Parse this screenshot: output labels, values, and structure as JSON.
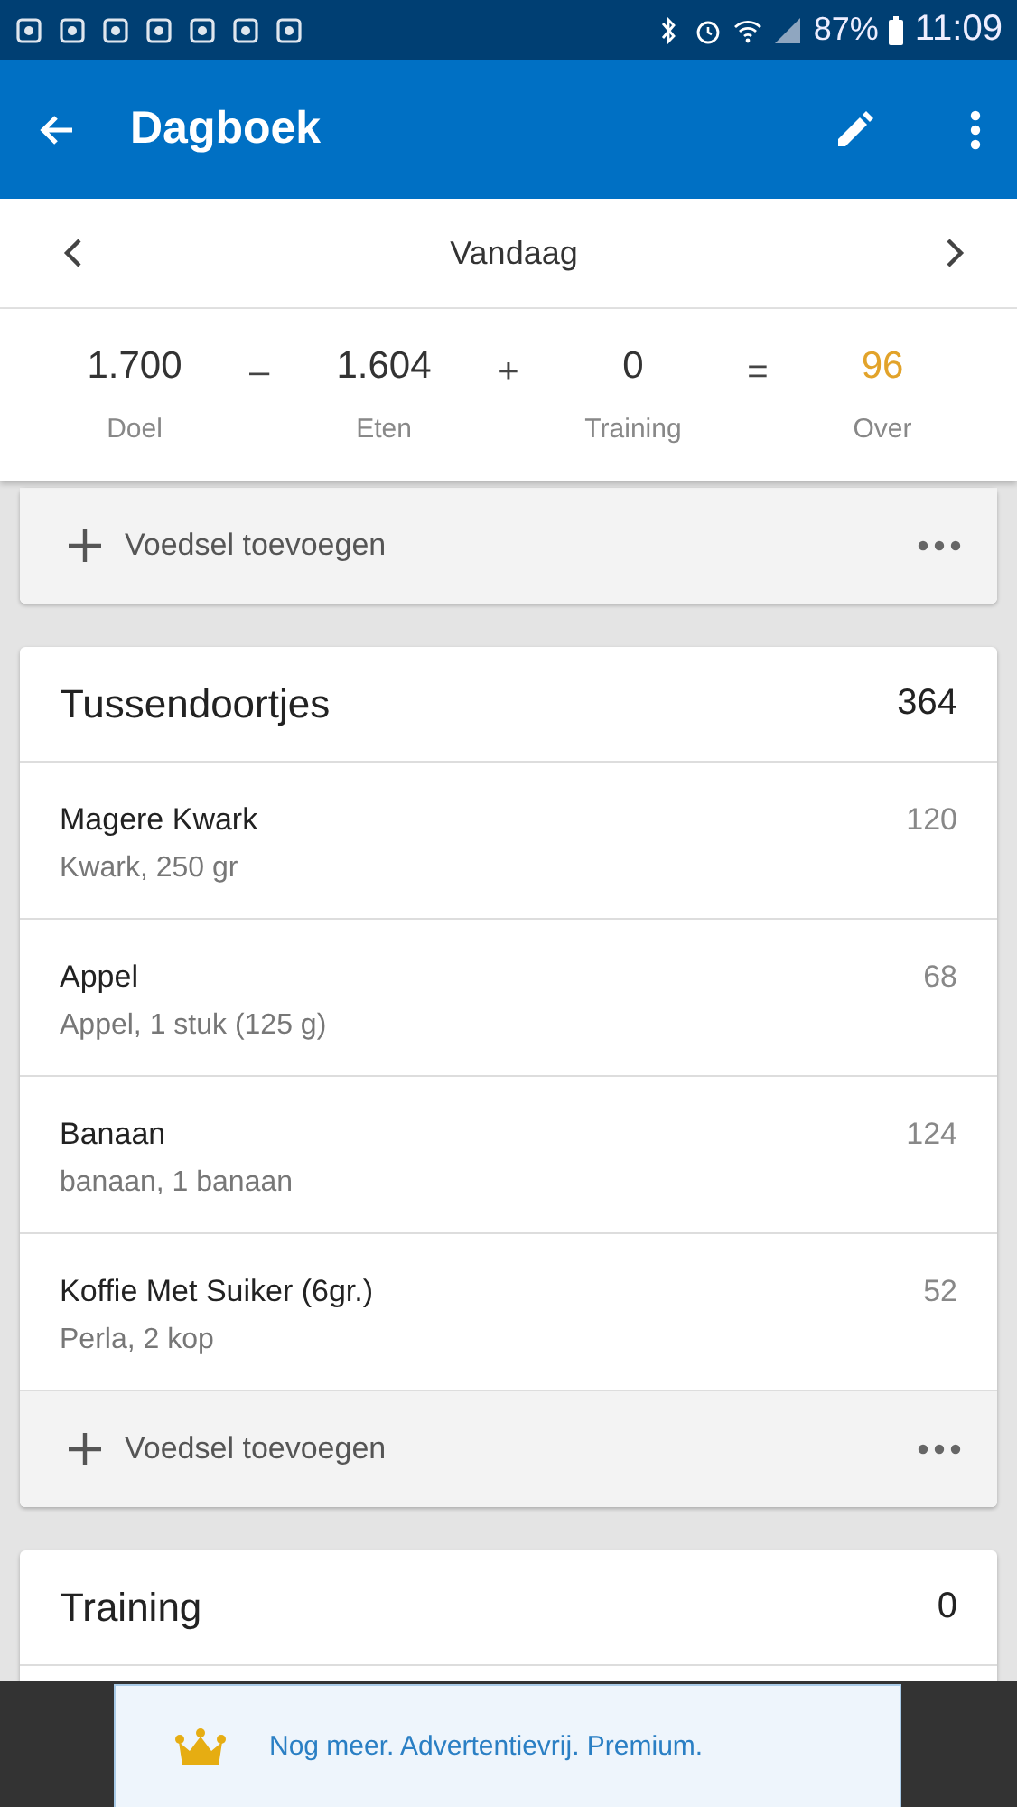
{
  "status_bar": {
    "battery": "87%",
    "time": "11:09"
  },
  "app_bar": {
    "title": "Dagboek"
  },
  "date_nav": {
    "label": "Vandaag"
  },
  "summary": {
    "items": [
      {
        "value": "1.700",
        "label": "Doel",
        "highlight": false
      },
      {
        "value": "1.604",
        "label": "Eten",
        "highlight": false
      },
      {
        "value": "0",
        "label": "Training",
        "highlight": false
      },
      {
        "value": "96",
        "label": "Over",
        "highlight": true
      }
    ],
    "operators": [
      "–",
      "+",
      "="
    ]
  },
  "partial_card": {
    "add_label": "Voedsel toevoegen"
  },
  "snacks": {
    "title": "Tussendoortjes",
    "total": "364",
    "entries": [
      {
        "name": "Magere Kwark",
        "detail": "Kwark, 250 gr",
        "calories": "120"
      },
      {
        "name": "Appel",
        "detail": "Appel, 1 stuk (125 g)",
        "calories": "68"
      },
      {
        "name": "Banaan",
        "detail": "banaan, 1 banaan",
        "calories": "124"
      },
      {
        "name": "Koffie Met Suiker (6gr.)",
        "detail": "Perla, 2 kop",
        "calories": "52"
      }
    ],
    "add_label": "Voedsel toevoegen"
  },
  "training": {
    "title": "Training",
    "total": "0"
  },
  "ad_banner": {
    "text": "Nog meer. Advertentievrij. Premium."
  }
}
